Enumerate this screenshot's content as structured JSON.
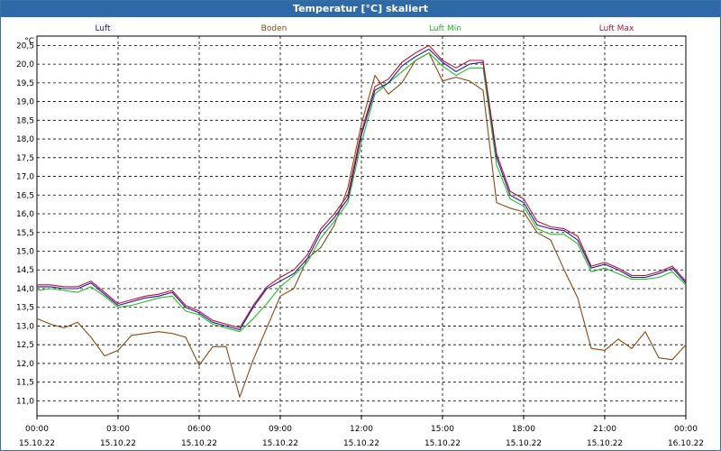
{
  "window_title": "Temperatur [°C] skaliert",
  "colors": {
    "titlebar": "#2e6aa8",
    "Luft": "#1a1aa8",
    "Boden": "#8b4a10",
    "Luft Min": "#1fbf1f",
    "Luft Max": "#c0102e"
  },
  "chart_data": {
    "type": "line",
    "title": "Temperatur [°C] skaliert",
    "ylabel": "°C",
    "xlabel": "",
    "ylim": [
      10.6,
      20.75
    ],
    "xlim": [
      0,
      24
    ],
    "grid": true,
    "legend_placement": "top",
    "y_ticks": [
      "11,0",
      "11,5",
      "12,0",
      "12,5",
      "13,0",
      "13,5",
      "14,0",
      "14,5",
      "15,0",
      "15,5",
      "16,0",
      "16,5",
      "17,0",
      "17,5",
      "18,0",
      "18,5",
      "19,0",
      "19,5",
      "20,0",
      "20,5"
    ],
    "x_ticks": [
      {
        "time": "00:00",
        "date": "15.10.22"
      },
      {
        "time": "03:00",
        "date": "15.10.22"
      },
      {
        "time": "06:00",
        "date": "15.10.22"
      },
      {
        "time": "09:00",
        "date": "15.10.22"
      },
      {
        "time": "12:00",
        "date": "15.10.22"
      },
      {
        "time": "15:00",
        "date": "15.10.22"
      },
      {
        "time": "18:00",
        "date": "15.10.22"
      },
      {
        "time": "21:00",
        "date": "15.10.22"
      },
      {
        "time": "00:00",
        "date": "16.10.22"
      }
    ],
    "x_hours": [
      0,
      0.5,
      1,
      1.5,
      2,
      2.5,
      3,
      3.5,
      4,
      4.5,
      5,
      5.5,
      6,
      6.5,
      7,
      7.5,
      8,
      8.5,
      9,
      9.5,
      10,
      10.5,
      11,
      11.5,
      12,
      12.5,
      13,
      13.5,
      14,
      14.5,
      15,
      15.5,
      16,
      16.5,
      17,
      17.5,
      18,
      18.5,
      19,
      19.5,
      20,
      20.5,
      21,
      21.5,
      22,
      22.5,
      23,
      23.5,
      24
    ],
    "series": [
      {
        "name": "Luft",
        "values": [
          14.05,
          14.05,
          14.0,
          14.0,
          14.15,
          13.85,
          13.55,
          13.65,
          13.75,
          13.8,
          13.9,
          13.5,
          13.35,
          13.1,
          13.0,
          12.9,
          13.5,
          14.0,
          14.2,
          14.4,
          14.8,
          15.5,
          15.9,
          16.4,
          18.1,
          19.3,
          19.5,
          19.95,
          20.2,
          20.4,
          20.05,
          19.8,
          20.0,
          20.05,
          17.5,
          16.5,
          16.3,
          15.7,
          15.6,
          15.55,
          15.3,
          14.55,
          14.65,
          14.5,
          14.3,
          14.3,
          14.4,
          14.55,
          14.15
        ]
      },
      {
        "name": "Boden",
        "values": [
          13.2,
          13.05,
          12.95,
          13.1,
          12.7,
          12.2,
          12.35,
          12.75,
          12.8,
          12.85,
          12.8,
          12.7,
          11.95,
          12.45,
          12.45,
          11.1,
          12.1,
          12.95,
          13.8,
          14.0,
          14.8,
          15.1,
          15.7,
          16.7,
          18.4,
          19.7,
          19.2,
          19.5,
          20.1,
          20.3,
          19.55,
          19.65,
          19.55,
          19.3,
          16.3,
          16.15,
          16.05,
          15.5,
          15.3,
          14.5,
          13.75,
          12.4,
          12.35,
          12.65,
          12.4,
          12.85,
          12.15,
          12.1,
          12.5
        ]
      },
      {
        "name": "Luft Min",
        "values": [
          13.95,
          14.0,
          13.95,
          13.9,
          14.05,
          13.8,
          13.5,
          13.55,
          13.65,
          13.75,
          13.8,
          13.4,
          13.3,
          13.05,
          12.95,
          12.85,
          13.2,
          13.6,
          14.05,
          14.35,
          14.7,
          15.35,
          15.8,
          16.3,
          17.9,
          19.2,
          19.5,
          19.8,
          20.1,
          20.3,
          19.95,
          19.7,
          19.9,
          19.9,
          17.3,
          16.4,
          16.2,
          15.6,
          15.45,
          15.45,
          15.2,
          14.45,
          14.55,
          14.4,
          14.25,
          14.25,
          14.3,
          14.45,
          14.1
        ]
      },
      {
        "name": "Luft Max",
        "values": [
          14.1,
          14.1,
          14.05,
          14.05,
          14.2,
          13.9,
          13.6,
          13.7,
          13.8,
          13.85,
          13.95,
          13.55,
          13.4,
          13.15,
          13.05,
          12.95,
          13.55,
          14.05,
          14.3,
          14.5,
          14.9,
          15.6,
          16.0,
          16.5,
          18.2,
          19.4,
          19.6,
          20.05,
          20.3,
          20.5,
          20.1,
          19.9,
          20.1,
          20.1,
          17.6,
          16.6,
          16.4,
          15.8,
          15.65,
          15.6,
          15.4,
          14.6,
          14.7,
          14.55,
          14.35,
          14.35,
          14.45,
          14.6,
          14.2
        ]
      }
    ]
  }
}
